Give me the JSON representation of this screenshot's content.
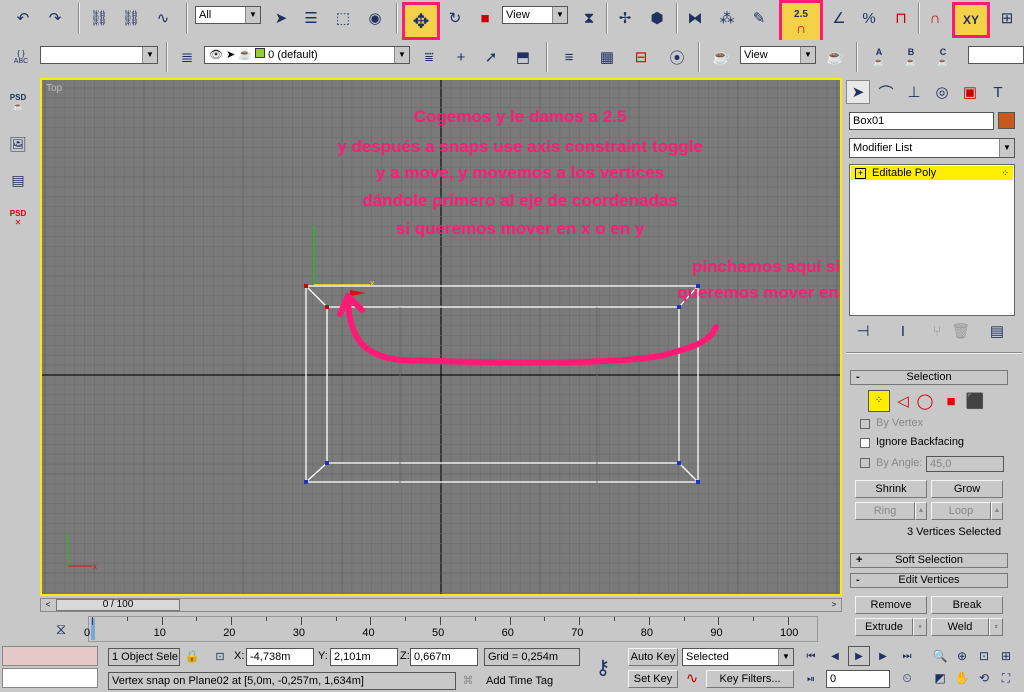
{
  "toolbar1": {
    "selection_filter": "All",
    "ref_coord": "View",
    "snap_label": "2.5",
    "axis_constraint_label": "XY"
  },
  "toolbar2": {
    "layer_label": "0 (default)",
    "view_dropdown": "View",
    "abc_label": "ABC",
    "named_views": [
      "A",
      "B",
      "C"
    ]
  },
  "viewport": {
    "label": "Top",
    "annotation_main": [
      "Cogemos y le damos a 2.5",
      "y después a snaps use axis constraint toggle",
      "y a move, y movemos a los vertices",
      "dándole primero al eje de coordenadas",
      "si queremos mover en x o en y"
    ],
    "annotation_side": [
      "pinchamos aquí si",
      "queremos mover en X"
    ],
    "gizmo_y": "y",
    "gizmo_x": "x",
    "world_axis_y": "y",
    "world_axis_x": "x",
    "colors": {
      "grid_bg": "#7a7a7a",
      "highlight_border": "#ffea00",
      "annotation": "#ff1a75"
    }
  },
  "command_panel": {
    "object_name": "Box01",
    "object_color": "#c65a1e",
    "modifier_list": "Modifier List",
    "stack_item": "Editable Poly",
    "selection_rollout": "Selection",
    "by_vertex": "By Vertex",
    "ignore_backfacing": "Ignore Backfacing",
    "by_angle": "By Angle:",
    "by_angle_value": "45,0",
    "shrink": "Shrink",
    "grow": "Grow",
    "ring": "Ring",
    "loop": "Loop",
    "selection_status": "3 Vertices Selected",
    "soft_selection": "Soft Selection",
    "edit_vertices": "Edit Vertices",
    "remove": "Remove",
    "break": "Break",
    "extrude": "Extrude",
    "weld": "Weld"
  },
  "timeline": {
    "slider_label": "0 / 100",
    "ticks": [
      "0",
      "10",
      "20",
      "30",
      "40",
      "50",
      "60",
      "70",
      "80",
      "90",
      "100"
    ]
  },
  "status": {
    "selection": "1 Object Sele",
    "x_label": "X:",
    "x_value": "-4,738m",
    "y_label": "Y:",
    "y_value": "2,101m",
    "z_label": "Z:",
    "z_value": "0,667m",
    "grid": "Grid = 0,254m",
    "prompt": "Vertex snap on Plane02 at [5,0m, -0,257m, 1,634m]",
    "add_time_tag": "Add Time Tag",
    "auto_key": "Auto Key",
    "set_key": "Set Key",
    "selected_dropdown": "Selected",
    "key_filters": "Key Filters...",
    "frame_value": "0"
  }
}
